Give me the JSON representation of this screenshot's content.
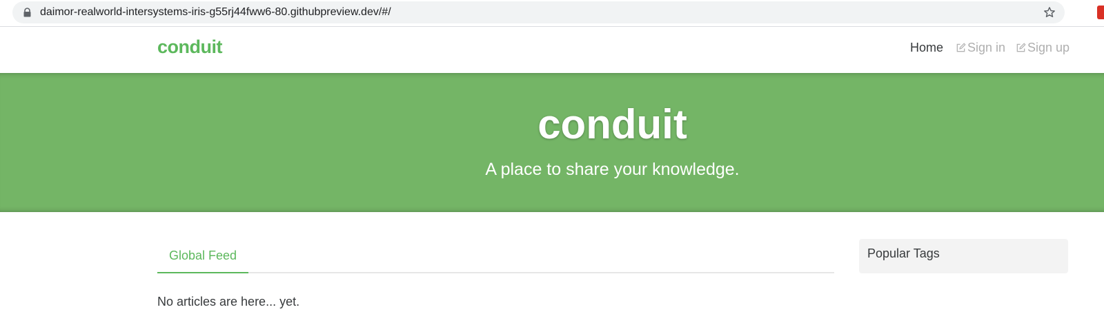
{
  "browser": {
    "url": "daimor-realworld-intersystems-iris-g55rj44fww6-80.githubpreview.dev/#/",
    "icons": [
      "lock-icon",
      "star-icon",
      "extension-icon"
    ]
  },
  "navbar": {
    "brand": "conduit",
    "links": [
      {
        "label": "Home",
        "active": true
      },
      {
        "label": "Sign in",
        "icon": "edit-icon"
      },
      {
        "label": "Sign up",
        "icon": "edit-icon"
      }
    ]
  },
  "banner": {
    "title": "conduit",
    "subtitle": "A place to share your knowledge."
  },
  "feed": {
    "tabs": [
      {
        "label": "Global Feed",
        "active": true
      }
    ],
    "empty_message": "No articles are here... yet."
  },
  "sidebar": {
    "title": "Popular Tags"
  },
  "colors": {
    "accent": "#5cb85c",
    "banner": "#74b566",
    "sidebar_bg": "#f3f3f3"
  }
}
